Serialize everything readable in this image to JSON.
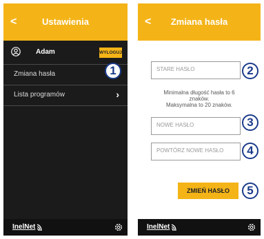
{
  "settings": {
    "back": "<",
    "title": "Ustawienia",
    "user_name": "Adam",
    "logout_label": "WYLOGUJ",
    "menu": [
      {
        "label": "Zmiana hasła"
      },
      {
        "label": "Lista programów"
      }
    ],
    "brand": "InelNet"
  },
  "password": {
    "back": "<",
    "title": "Zmiana hasła",
    "old_placeholder": "STARE HASŁO",
    "info_line1": "Minimalna długość hasła to 6",
    "info_line2": "znaków.",
    "info_line3": "Maksymalna to 20 znaków.",
    "new_placeholder": "NOWE HASŁO",
    "repeat_placeholder": "POWTÓRZ NOWE HASŁO",
    "button_label": "ZMIEŃ HASŁO",
    "brand": "InelNet"
  },
  "badges": [
    "1",
    "2",
    "3",
    "4",
    "5"
  ],
  "colors": {
    "accent": "#f4b418",
    "dark_bg": "#1b1b1b",
    "badge": "#1a3a8a"
  }
}
